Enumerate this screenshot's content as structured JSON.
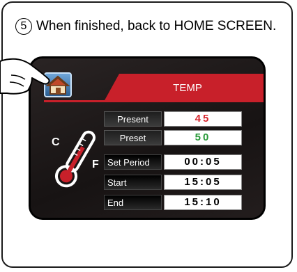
{
  "instruction": {
    "step_number": "5",
    "text": "When finished, back to HOME SCREEN."
  },
  "screen": {
    "tab_title": "TEMP",
    "rows": [
      {
        "label": "Present",
        "value": "45"
      },
      {
        "label": "Preset",
        "value": "50"
      },
      {
        "label": "Set Period",
        "value": "00:05"
      },
      {
        "label": "Start",
        "value": "15:05"
      },
      {
        "label": "End",
        "value": "15:10"
      }
    ],
    "thermo_left_letter": "C",
    "thermo_right_letter": "F"
  },
  "icons": {
    "home": "home-icon",
    "thermometer": "thermometer-icon",
    "hand": "pointing-hand-icon"
  },
  "colors": {
    "accent_red": "#c8202a",
    "present_value": "#d7262e",
    "preset_value": "#2a9a3a",
    "screen_bg": "#1f1a1a"
  }
}
